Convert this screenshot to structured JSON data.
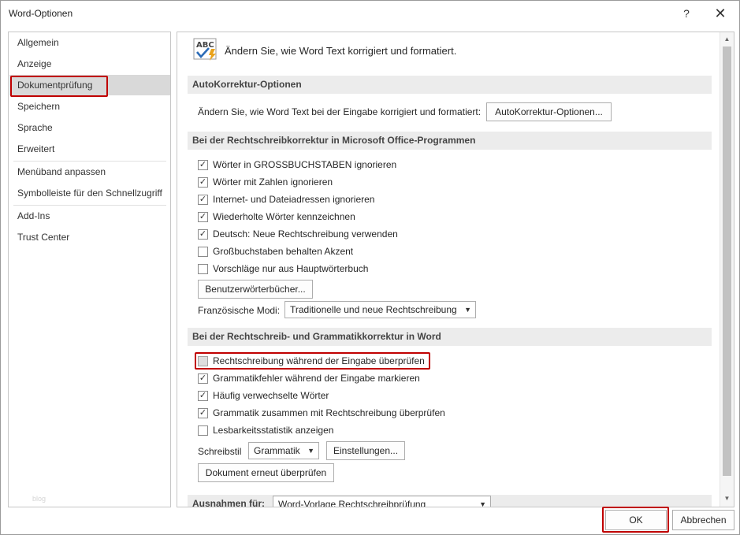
{
  "window": {
    "title": "Word-Optionen",
    "help_label": "?",
    "close_label": "✕"
  },
  "nav": {
    "items": [
      {
        "label": "Allgemein"
      },
      {
        "label": "Anzeige"
      },
      {
        "label": "Dokumentprüfung"
      },
      {
        "label": "Speichern"
      },
      {
        "label": "Sprache"
      },
      {
        "label": "Erweitert"
      },
      {
        "label": "Menüband anpassen"
      },
      {
        "label": "Symbolleiste für den Schnellzugriff"
      },
      {
        "label": "Add-Ins"
      },
      {
        "label": "Trust Center"
      }
    ],
    "selected_index": 2,
    "watermark": "blog"
  },
  "header": {
    "icon_text": "ABC",
    "text": "Ändern Sie, wie Word Text korrigiert und formatiert."
  },
  "autocorrect": {
    "title": "AutoKorrektur-Optionen",
    "description": "Ändern Sie, wie Word Text bei der Eingabe korrigiert und formatiert:",
    "button": "AutoKorrektur-Optionen..."
  },
  "office_spelling": {
    "title": "Bei der Rechtschreibkorrektur in Microsoft Office-Programmen",
    "options": [
      {
        "label": "Wörter in GROSSBUCHSTABEN ignorieren",
        "checked": true
      },
      {
        "label": "Wörter mit Zahlen ignorieren",
        "checked": true
      },
      {
        "label": "Internet- und Dateiadressen ignorieren",
        "checked": true
      },
      {
        "label": "Wiederholte Wörter kennzeichnen",
        "checked": true
      },
      {
        "label": "Deutsch: Neue Rechtschreibung verwenden",
        "checked": true
      },
      {
        "label": "Großbuchstaben behalten Akzent",
        "checked": false
      },
      {
        "label": "Vorschläge nur aus Hauptwörterbuch",
        "checked": false
      }
    ],
    "dictionaries_button": "Benutzerwörterbücher...",
    "french_modes_label": "Französische Modi:",
    "french_modes_value": "Traditionelle und neue Rechtschreibung"
  },
  "word_spelling": {
    "title": "Bei der Rechtschreib- und Grammatikkorrektur in Word",
    "options": [
      {
        "label": "Rechtschreibung während der Eingabe überprüfen",
        "checked": false
      },
      {
        "label": "Grammatikfehler während der Eingabe markieren",
        "checked": true
      },
      {
        "label": "Häufig verwechselte Wörter",
        "checked": true
      },
      {
        "label": "Grammatik zusammen mit Rechtschreibung überprüfen",
        "checked": true
      },
      {
        "label": "Lesbarkeitsstatistik anzeigen",
        "checked": false
      }
    ],
    "style_label": "Schreibstil",
    "style_value": "Grammatik",
    "settings_button": "Einstellungen...",
    "recheck_button": "Dokument erneut überprüfen"
  },
  "exceptions": {
    "label": "Ausnahmen für:",
    "value": "Word-Vorlage Rechtschreibprüfung"
  },
  "footer": {
    "ok": "OK",
    "cancel": "Abbrechen"
  },
  "colors": {
    "highlight": "#c00000",
    "selected_nav": "#d9d9d9",
    "section_bg": "#ececec"
  }
}
